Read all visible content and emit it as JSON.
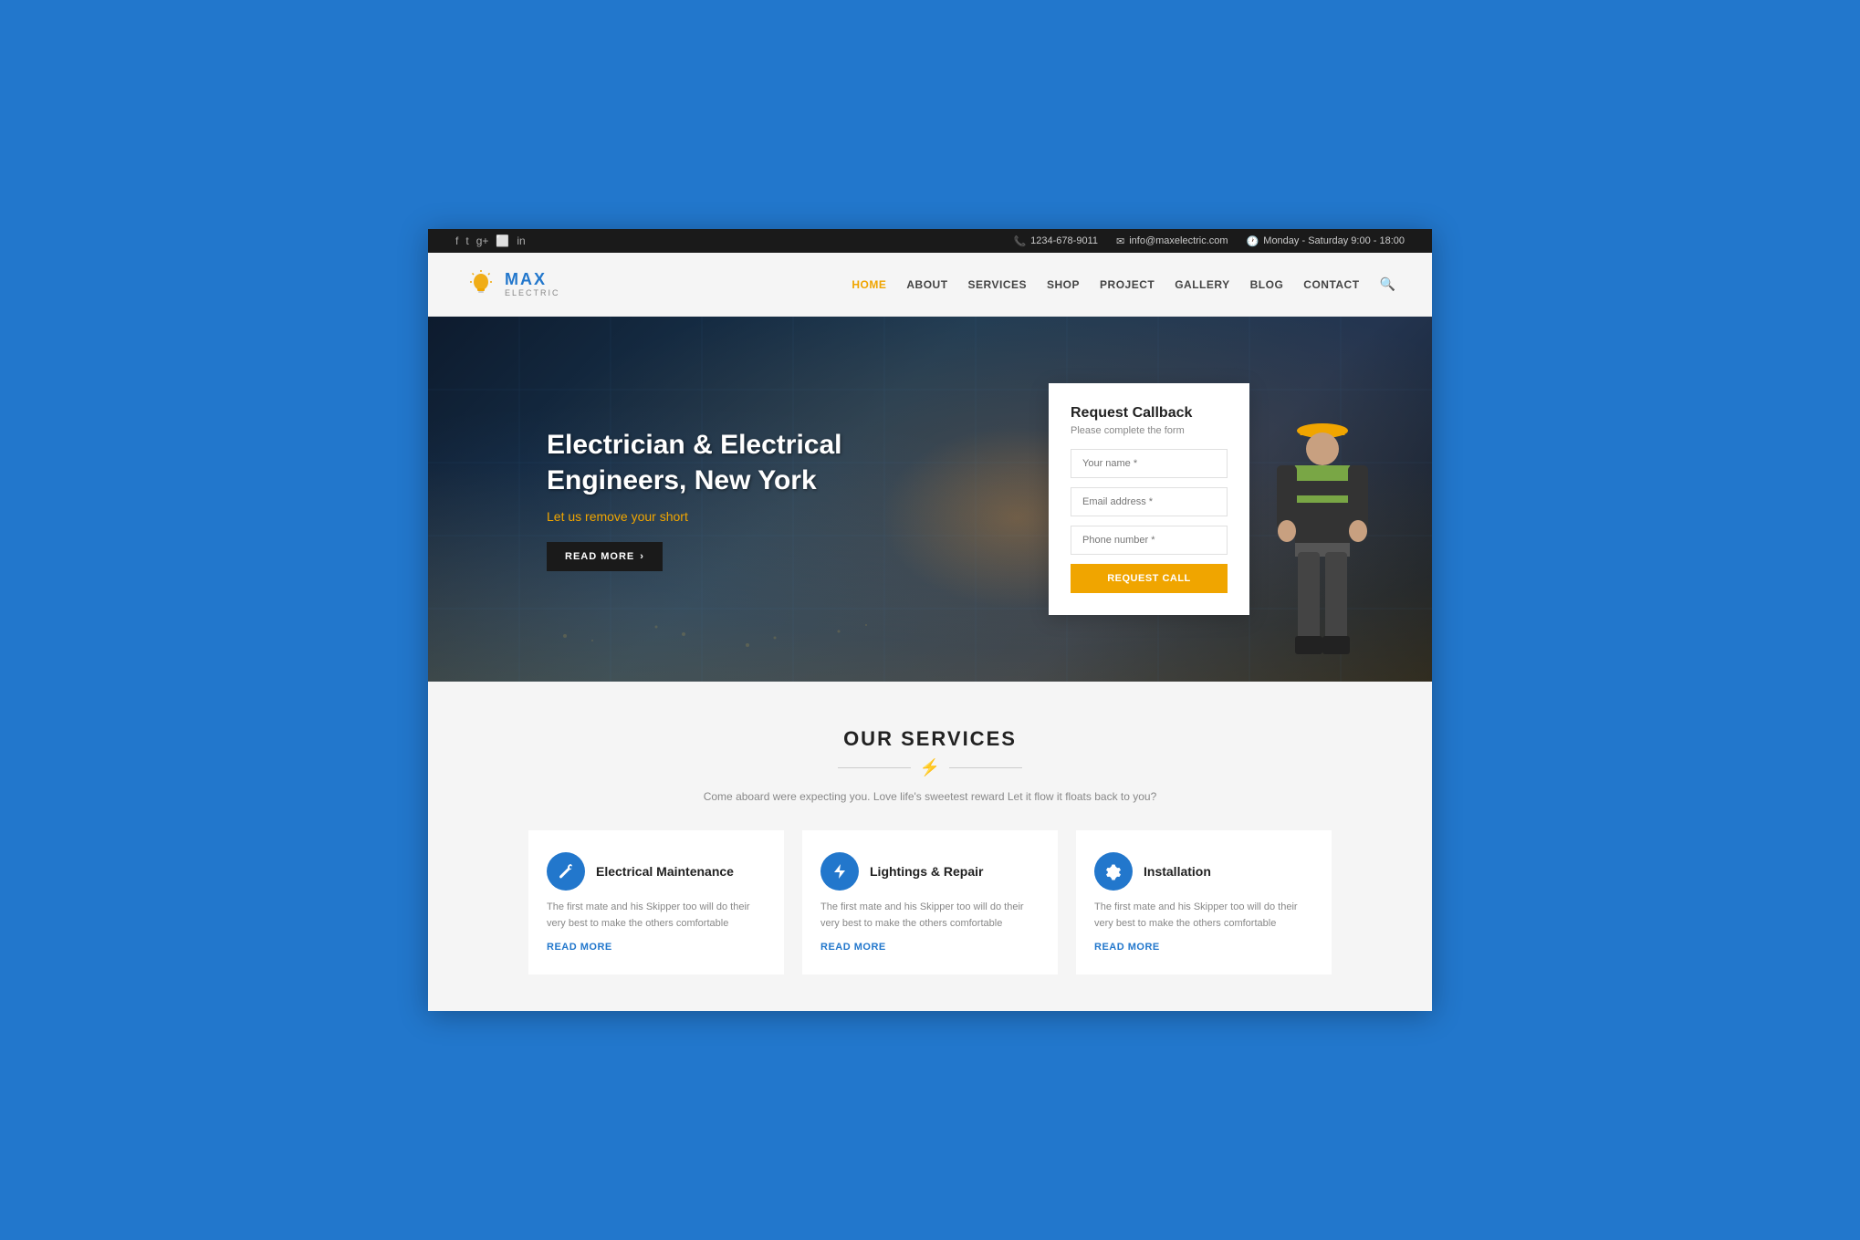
{
  "topbar": {
    "phone": "1234-678-9011",
    "email": "info@maxelectric.com",
    "hours": "Monday - Saturday 9:00 - 18:00",
    "socials": [
      "f",
      "t",
      "g+",
      "📷",
      "in"
    ]
  },
  "header": {
    "logo_max": "MAX",
    "logo_electric": "ELECTRIC",
    "nav_items": [
      {
        "label": "HOME",
        "active": true
      },
      {
        "label": "ABOUT",
        "active": false
      },
      {
        "label": "SERVICES",
        "active": false
      },
      {
        "label": "SHOP",
        "active": false
      },
      {
        "label": "PROJECT",
        "active": false
      },
      {
        "label": "GALLERY",
        "active": false
      },
      {
        "label": "BLOG",
        "active": false
      },
      {
        "label": "CONTACT",
        "active": false
      }
    ]
  },
  "hero": {
    "title_line1": "Electrician & Electrical",
    "title_line2": "Engineers, New York",
    "subtitle": "Let us remove your short",
    "read_more": "READ MORE",
    "callback_form": {
      "title": "Request Callback",
      "subtitle": "Please complete the form",
      "name_placeholder": "Your name *",
      "email_placeholder": "Email address *",
      "phone_placeholder": "Phone number *",
      "button_label": "REQUEST CALL"
    }
  },
  "services": {
    "title": "OUR SERVICES",
    "description": "Come aboard were expecting you. Love life's sweetest reward Let it flow it floats back to you?",
    "items": [
      {
        "icon": "🔧",
        "name": "Electrical Maintenance",
        "description": "The first mate and his Skipper too will do their very best to make the others comfortable",
        "link": "READ MORE"
      },
      {
        "icon": "⚡",
        "name": "Lightings & Repair",
        "description": "The first mate and his Skipper too will do their very best to make the others comfortable",
        "link": "READ MORE"
      },
      {
        "icon": "🔩",
        "name": "Installation",
        "description": "The first mate and his Skipper too will do their very best to make the others comfortable",
        "link": "READ MORE"
      }
    ]
  }
}
